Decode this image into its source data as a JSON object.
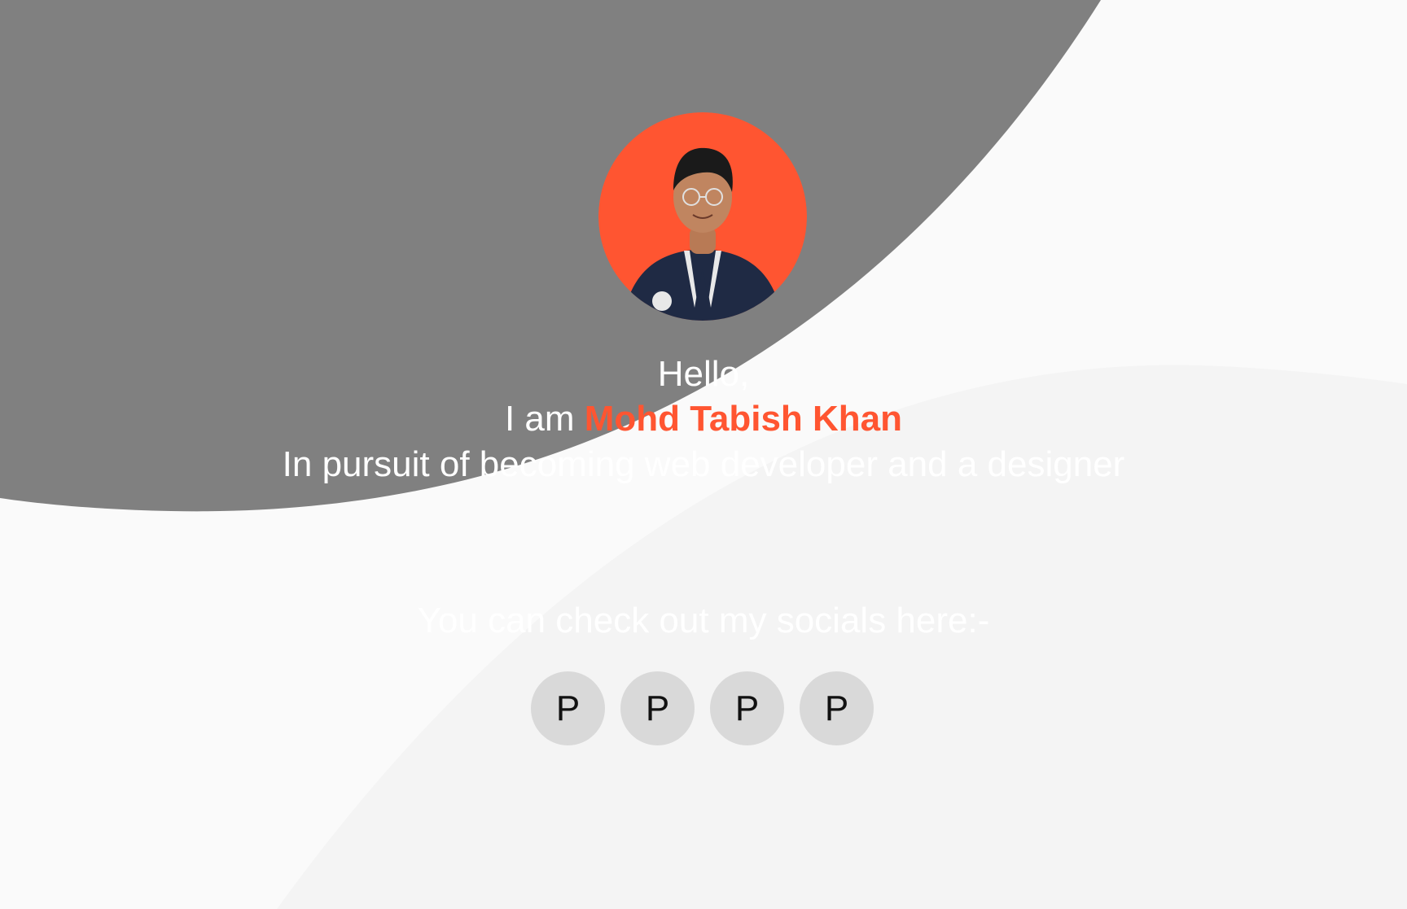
{
  "hero": {
    "greeting": "Hello,",
    "name_prefix": "I am",
    "name": "Mohd Tabish Khan",
    "tagline": "In pursuit of becoming web developer and a designer"
  },
  "socials": {
    "heading": "You can check out my socials here:-",
    "items": [
      {
        "label": "P"
      },
      {
        "label": "P"
      },
      {
        "label": "P"
      },
      {
        "label": "P"
      }
    ]
  },
  "colors": {
    "accent": "#ff5531",
    "dark_shape": "#808080",
    "light_shape": "#f4f4f4",
    "background": "#fafafa",
    "social_button": "#d9d9d9"
  }
}
